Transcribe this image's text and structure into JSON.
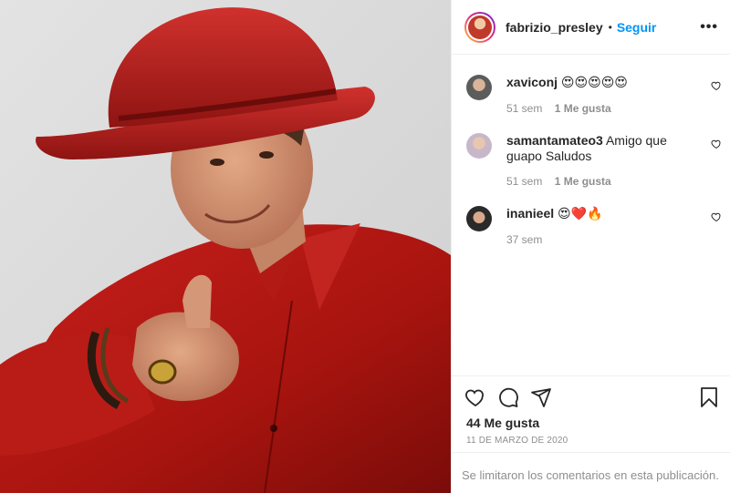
{
  "post": {
    "image_alt": "man in red cowboy hat and red shirt pointing at camera",
    "author": "fabrizio_presley",
    "separator": "•",
    "follow_label": "Seguir",
    "more_label": "•••"
  },
  "comments": [
    {
      "user": "xaviconj",
      "text": "😍😍😍😍😍",
      "time": "51 sem",
      "likes": "1 Me gusta"
    },
    {
      "user": "samantamateo3",
      "text": "Amigo que guapo Saludos",
      "time": "51 sem",
      "likes": "1 Me gusta"
    },
    {
      "user": "inanieel",
      "text": "😍❤️🔥",
      "time": "37 sem",
      "likes": ""
    }
  ],
  "footer": {
    "likes_count": "44 Me gusta",
    "date": "11 DE MARZO DE 2020",
    "comments_limited": "Se limitaron los comentarios en esta publicación."
  },
  "colors": {
    "accent": "#0095f6",
    "muted": "#8e8e8e",
    "border": "#efefef"
  },
  "icons": [
    "heart-icon",
    "comment-icon",
    "share-icon",
    "bookmark-icon",
    "more-options-icon"
  ]
}
